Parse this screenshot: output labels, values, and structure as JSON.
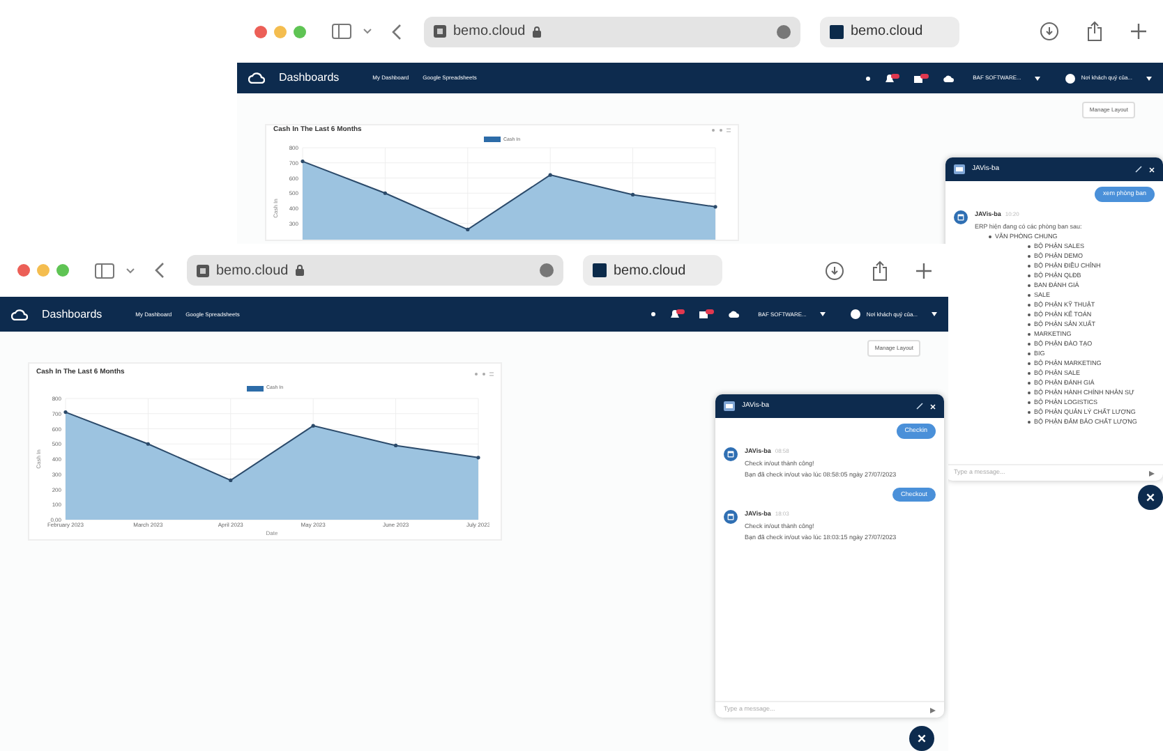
{
  "windows": [
    {
      "kind": "back",
      "browser": {
        "address": "bemo.cloud",
        "tab": "bemo.cloud"
      },
      "navbar": {
        "brand": "Dashboards",
        "links": [
          "My Dashboard",
          "Google Spreadsheets"
        ],
        "company": "BAF SOFTWARE...",
        "user": "Nơi khách quý của..."
      },
      "manage_layout": "Manage Layout",
      "card": {
        "title": "Cash In The Last 6 Months",
        "chart_data": {
          "type": "area",
          "grid": true,
          "ylabel": "Cash In",
          "ylim": [
            0,
            800
          ],
          "yticks": [
            300,
            400,
            500,
            600,
            700,
            800
          ],
          "series": [
            {
              "name": "Cash In",
              "color": "#9cc3e0",
              "values": [
                710,
                500,
                260,
                620,
                490,
                410
              ]
            }
          ]
        }
      },
      "chat": {
        "title": "JAVis-ba",
        "placeholder": "Type a message...",
        "messages": [
          {
            "kind": "user",
            "text": "xem phòng ban"
          },
          {
            "kind": "bot",
            "name": "JAVis-ba",
            "time": "10:20",
            "lines": [
              "ERP hiện đang có các phòng ban sau:"
            ],
            "list": [
              {
                "text": "VĂN PHÒNG CHUNG",
                "children": [
                  {
                    "text": "BỘ PHẬN SALES"
                  },
                  {
                    "text": "BỘ PHẬN DEMO"
                  },
                  {
                    "text": "BỘ PHẬN ĐIỀU CHỈNH"
                  },
                  {
                    "text": "BỘ PHẬN QLĐB"
                  },
                  {
                    "text": "BAN ĐÁNH GIÁ"
                  },
                  {
                    "text": "SALE"
                  },
                  {
                    "text": "BỘ PHẬN KỸ THUẬT"
                  },
                  {
                    "text": "BỘ PHẬN KẾ TOÁN"
                  },
                  {
                    "text": "BỘ PHẬN SẢN XUẤT"
                  },
                  {
                    "text": "MARKETING"
                  },
                  {
                    "text": "BỘ PHẬN ĐÀO TẠO"
                  },
                  {
                    "text": "BIG"
                  },
                  {
                    "text": "BỘ PHẬN MARKETING"
                  },
                  {
                    "text": "BỘ PHẬN SALE"
                  },
                  {
                    "text": "BỘ PHẬN ĐÁNH GIÁ"
                  },
                  {
                    "text": "BỘ PHẬN HÀNH CHÍNH NHÂN SỰ"
                  },
                  {
                    "text": "BỘ PHẬN LOGISTICS"
                  },
                  {
                    "text": "BỘ PHẬN QUẢN LÝ CHẤT LƯỢNG"
                  },
                  {
                    "text": "BỘ PHẬN ĐẢM BẢO CHẤT LƯỢNG"
                  }
                ]
              }
            ]
          }
        ]
      }
    },
    {
      "kind": "front",
      "browser": {
        "address": "bemo.cloud",
        "tab": "bemo.cloud"
      },
      "navbar": {
        "brand": "Dashboards",
        "links": [
          "My Dashboard",
          "Google Spreadsheets"
        ],
        "company": "BAF SOFTWARE...",
        "user": "Nơi khách quý của..."
      },
      "manage_layout": "Manage Layout",
      "card": {
        "title": "Cash In The Last 6 Months",
        "chart_data": {
          "type": "area",
          "grid": true,
          "xlabel": "Date",
          "ylabel": "Cash In",
          "categories": [
            "February 2023",
            "March 2023",
            "April 2023",
            "May 2023",
            "June 2023",
            "July 2023"
          ],
          "ylim": [
            0,
            800
          ],
          "yticks": [
            {
              "value": 0,
              "label": "0.00"
            },
            100,
            200,
            300,
            400,
            500,
            600,
            700,
            800
          ],
          "series": [
            {
              "name": "Cash In",
              "color": "#9cc3e0",
              "values": [
                710,
                500,
                260,
                620,
                490,
                410
              ]
            }
          ]
        }
      },
      "chat": {
        "title": "JAVis-ba",
        "placeholder": "Type a message...",
        "messages": [
          {
            "kind": "user",
            "text": "Checkin"
          },
          {
            "kind": "bot",
            "name": "JAVis-ba",
            "time": "08:58",
            "lines": [
              "Check in/out thành công!",
              "Bạn đã check in/out vào lúc 08:58:05 ngày 27/07/2023"
            ]
          },
          {
            "kind": "user",
            "text": "Checkout"
          },
          {
            "kind": "bot",
            "name": "JAVis-ba",
            "time": "18:03",
            "lines": [
              "Check in/out thành công!",
              "Bạn đã check in/out vào lúc 18:03:15 ngày 27/07/2023"
            ]
          }
        ]
      }
    }
  ]
}
